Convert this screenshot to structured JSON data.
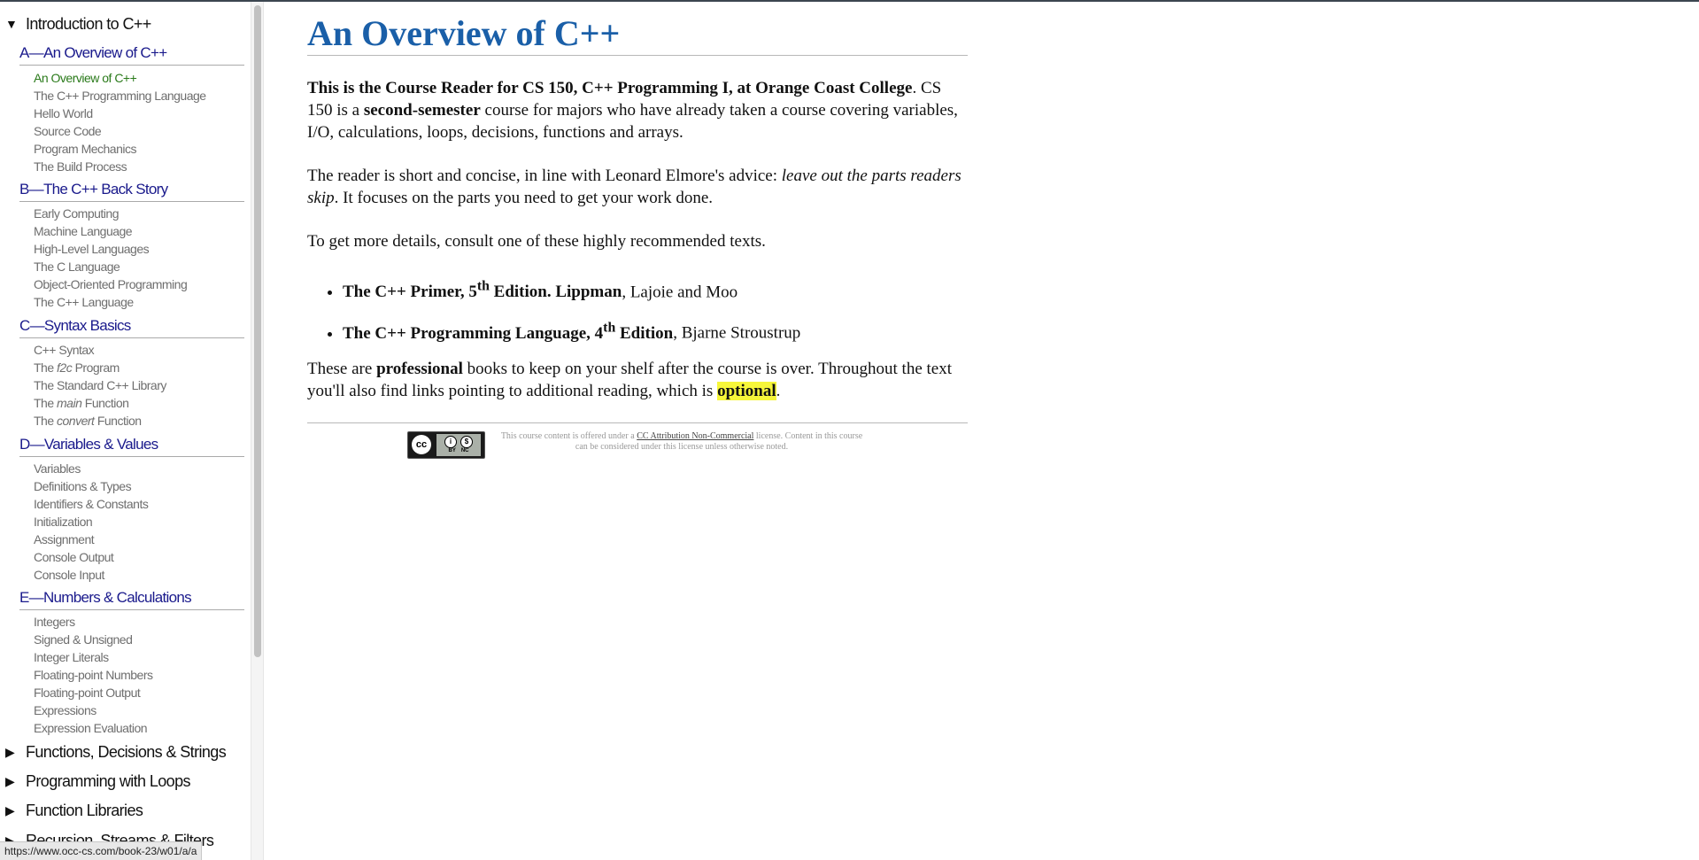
{
  "sidebar": {
    "sections": [
      {
        "label": "Introduction to C++",
        "expanded": true
      },
      {
        "label": "Functions, Decisions & Strings",
        "expanded": false
      },
      {
        "label": "Programming with Loops",
        "expanded": false
      },
      {
        "label": "Function Libraries",
        "expanded": false
      },
      {
        "label": "Recursion, Streams & Filters",
        "expanded": false
      }
    ],
    "chapters": [
      {
        "label": "A—An Overview of C++",
        "lessons": [
          "An Overview of C++",
          "The C++ Programming Language",
          "Hello World",
          "Source Code",
          "Program Mechanics",
          "The Build Process"
        ]
      },
      {
        "label": "B—The C++ Back Story",
        "lessons": [
          "Early Computing",
          "Machine Language",
          "High-Level Languages",
          "The C Language",
          "Object-Oriented Programming",
          "The C++ Language"
        ]
      },
      {
        "label": "C—Syntax Basics",
        "lessons": [
          "C++ Syntax",
          {
            "pre": "The ",
            "it": "f2c",
            "post": " Program"
          },
          "The Standard C++ Library",
          {
            "pre": "The ",
            "it": "main",
            "post": " Function"
          },
          {
            "pre": "The ",
            "it": "convert",
            "post": " Function"
          }
        ]
      },
      {
        "label": "D—Variables & Values",
        "lessons": [
          "Variables",
          "Definitions & Types",
          "Identifiers & Constants",
          "Initialization",
          "Assignment",
          "Console Output",
          "Console Input"
        ]
      },
      {
        "label": "E—Numbers & Calculations",
        "lessons": [
          "Integers",
          "Signed & Unsigned",
          "Integer Literals",
          "Floating-point Numbers",
          "Floating-point Output",
          "Expressions",
          "Expression Evaluation"
        ]
      }
    ],
    "active_lesson": "An Overview of C++"
  },
  "main": {
    "title": "An Overview of C++",
    "p1": {
      "bold1": "This is the Course Reader for CS 150, C++ Programming I, at Orange Coast College",
      "t1": ". CS 150 is a ",
      "bold2": "second-semester",
      "t2": " course for majors who have already taken a course covering variables, I/O, calculations, loops, decisions, functions and arrays."
    },
    "p2": {
      "t1": "The reader is short and concise, in line with Leonard Elmore's advice: ",
      "italic": "leave out the parts readers skip",
      "t2": ". It focuses on the parts you need to get your work done."
    },
    "p3": "To get more details, consult one of these highly recommended texts.",
    "books": [
      {
        "title_a": "The C++ Primer, 5",
        "sup": "th",
        "title_b": " Edition. Lippman",
        "rest": ", Lajoie and Moo"
      },
      {
        "title_a": "The C++ Programming Language, 4",
        "sup": "th",
        "title_b": " Edition",
        "rest": ", Bjarne Stroustrup"
      }
    ],
    "p4": {
      "t1": "These are ",
      "bold": "professional",
      "t2": " books to keep on your shelf after the course is over. Throughout the text you'll also find links pointing to additional reading, which is ",
      "highlight": "optional",
      "t3": "."
    }
  },
  "footer": {
    "badge": {
      "cc": "cc",
      "by": "BY",
      "nc": "NC"
    },
    "license_pre": "This course content is offered under a ",
    "license_link": "CC Attribution Non-Commercial",
    "license_post": " license. Content in this course can be considered under this license unless otherwise noted."
  },
  "statusbar": {
    "url": "https://www.occ-cs.com/book-23/w01/a/a"
  },
  "colors": {
    "title": "#1a5fa8",
    "chapter": "#1a1a8c",
    "lesson": "#6e6e6e",
    "active_lesson": "#2a7a1a",
    "highlight": "#f6f63a"
  }
}
